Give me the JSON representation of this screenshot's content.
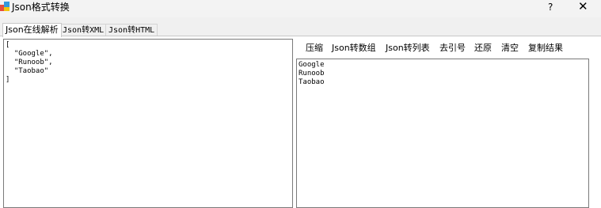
{
  "window": {
    "title": "Json格式转换",
    "help_label": "?",
    "close_label": "✕"
  },
  "tabs": [
    {
      "label": "Json在线解析",
      "active": true
    },
    {
      "label": "Json转XML",
      "active": false
    },
    {
      "label": "Json转HTML",
      "active": false
    }
  ],
  "input": {
    "lines": [
      "[",
      "  \"Google\",",
      "  \"Runoob\",",
      "  \"Taobao\"",
      "]"
    ]
  },
  "toolbar": {
    "compress": "压缩",
    "to_array": "Json转数组",
    "to_list": "Json转列表",
    "remove_quotes": "去引号",
    "restore": "还原",
    "clear": "清空",
    "copy_result": "复制结果"
  },
  "output": {
    "lines": [
      "Google",
      "Runoob",
      "Taobao"
    ]
  },
  "colors": {
    "window_bg": "#f0f0f0",
    "panel_bg": "#ffffff",
    "border": "#7a7a7a"
  },
  "icons": {
    "app": "app-icon",
    "close": "close-icon"
  }
}
